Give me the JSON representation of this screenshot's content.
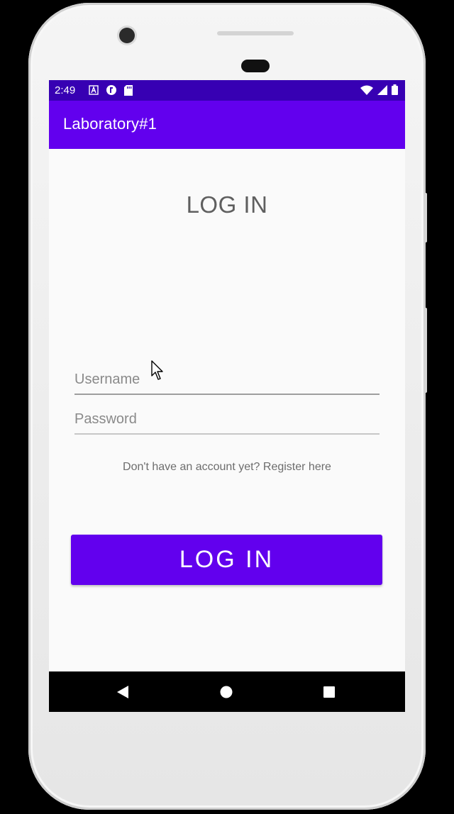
{
  "status_bar": {
    "time": "2:49",
    "background_color": "#3700b3"
  },
  "app_bar": {
    "title": "Laboratory#1",
    "background_color": "#6200ee"
  },
  "login_form": {
    "heading": "LOG IN",
    "username_placeholder": "Username",
    "username_value": "",
    "password_placeholder": "Password",
    "password_value": "",
    "register_link": "Don't have an account yet? Register here",
    "login_button_label": "LOG IN",
    "accent_color": "#6200ee"
  },
  "navigation_bar": {
    "icons": [
      "back-icon",
      "home-icon",
      "recents-icon"
    ]
  }
}
